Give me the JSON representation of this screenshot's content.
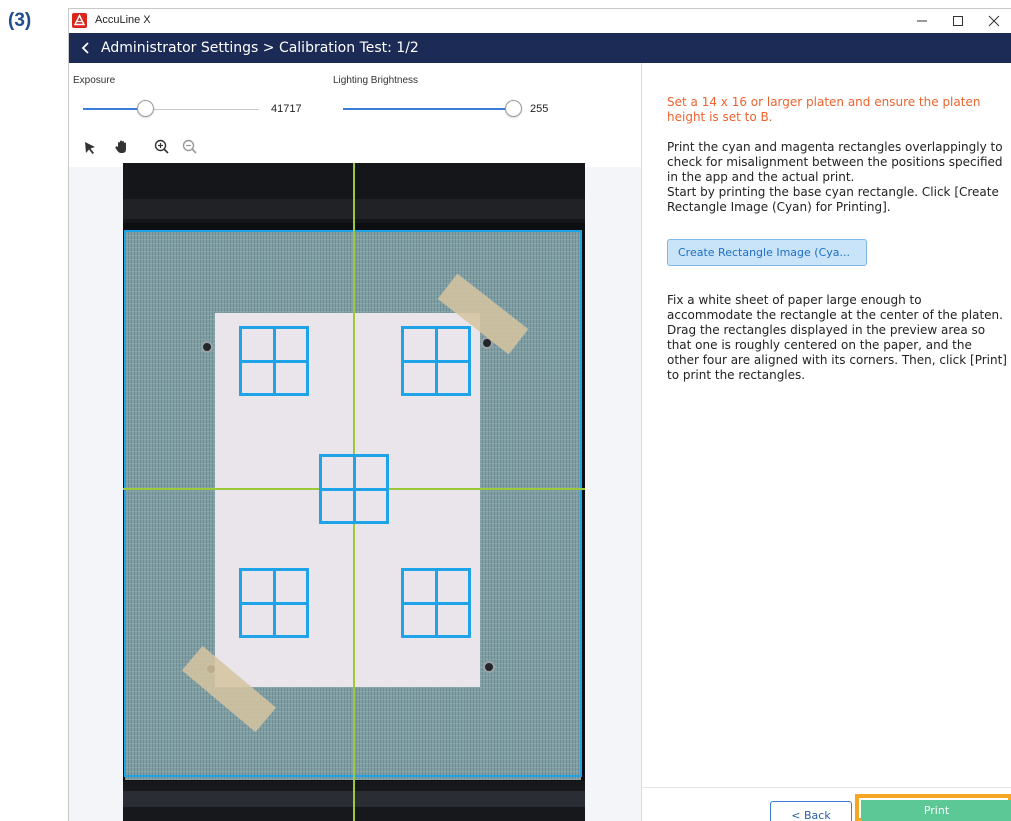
{
  "step_label": "(3)",
  "window": {
    "app_title": "AccuLine X",
    "header_title": "Administrator Settings > Calibration Test: 1/2"
  },
  "controls": {
    "exposure": {
      "label": "Exposure",
      "value": "41717",
      "level": 0.35
    },
    "brightness": {
      "label": "Lighting Brightness",
      "value": "255",
      "level": 1.0
    }
  },
  "right_panel": {
    "warning": "Set a 14 x 16 or larger platen and ensure the platen height is set to B.",
    "instructions_1": "Print the cyan and magenta rectangles overlappingly to check for misalignment between the positions specified in the app and the actual print.\nStart by printing the base cyan rectangle. Click [Create Rectangle Image (Cyan) for Printing].",
    "create_button": "Create Rectangle Image (Cya...",
    "instructions_2": "Fix a white sheet of paper large enough to accommodate the rectangle at the center of the platen. Drag the rectangles displayed in the preview area so that one is roughly centered on the paper, and the other four are aligned with its corners. Then, click [Print] to print the rectangles."
  },
  "footer": {
    "back_label": "< Back",
    "print_label": "Print"
  },
  "colors": {
    "header": "#1b2b55",
    "warning": "#f0622e",
    "calibration_rect": "#1ea2e8",
    "crosshair": "#9bc93a",
    "print_button": "#5cc896",
    "highlight": "#f5a623"
  },
  "icons": [
    "app-logo-icon",
    "minimize-icon",
    "maximize-icon",
    "close-icon",
    "back-chevron-icon",
    "pointer-tool-icon",
    "hand-tool-icon",
    "zoom-in-icon",
    "zoom-out-icon"
  ]
}
